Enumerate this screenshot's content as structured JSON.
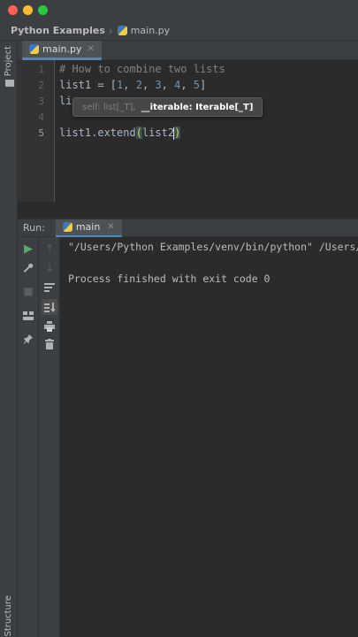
{
  "navbar": {
    "project": "Python Examples",
    "file": "main.py"
  },
  "left_strip": {
    "project_label": "Project",
    "structure_label": "Structure"
  },
  "editor": {
    "tab": {
      "label": "main.py"
    },
    "line_numbers": [
      "1",
      "2",
      "3",
      "4",
      "5"
    ],
    "lines": {
      "l1_comment": "# How to combine two lists",
      "l2_prefix": "list1 = [",
      "l2_n1": "1",
      "l2_n2": "2",
      "l2_n3": "3",
      "l2_n4": "4",
      "l2_n5": "5",
      "l3_visible": "lis",
      "l5_prefix": "list1.extend",
      "l5_paren_open": "(",
      "l5_arg": "list2",
      "l5_paren_close": ")"
    },
    "param_hint": {
      "dim": "self: list[_T],",
      "strong": "__iterable: Iterable[_T]"
    }
  },
  "run_panel": {
    "label": "Run:",
    "tab": "main",
    "output_line_1": "\"/Users/Python Examples/venv/bin/python\" /Users/P",
    "output_line_2": "Process finished with exit code 0"
  },
  "icons": {
    "run": "play-icon",
    "wrench": "wrench-icon",
    "stop": "stop-icon",
    "layout": "layout-icon",
    "pin": "pin-icon",
    "up": "arrow-up-icon",
    "down": "arrow-down-icon",
    "wrap": "soft-wrap-icon",
    "scroll": "scroll-to-end-icon",
    "print": "print-icon",
    "trash": "trash-icon"
  },
  "colors": {
    "accent": "#4a88c7",
    "run_green": "#59a869",
    "comment": "#808080",
    "number": "#6897bb"
  }
}
